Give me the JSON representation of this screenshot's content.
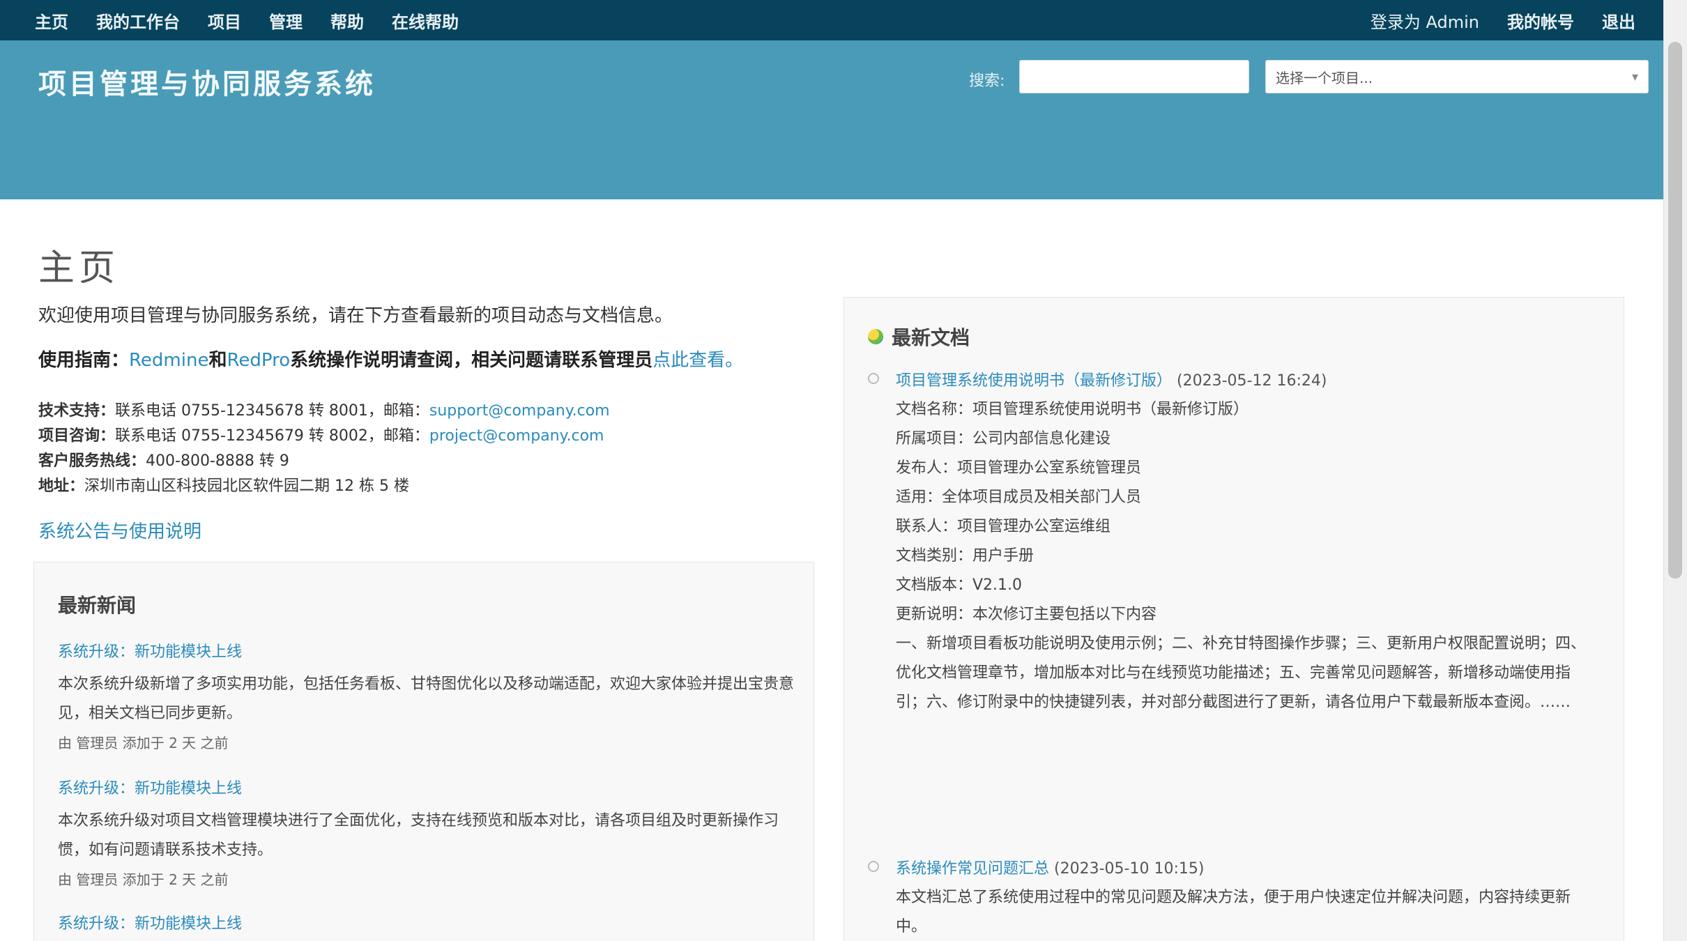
{
  "topbar": {
    "left_items": [
      "主页",
      "我的工作台",
      "项目",
      "管理",
      "帮助",
      "在线帮助"
    ],
    "right_items": [
      "登录为 Admin",
      "我的帐号",
      "退出"
    ]
  },
  "header": {
    "site_title": "项目管理与协同服务系统",
    "search_label": "搜索:",
    "search_value": "",
    "project_select": "选择一个项目..."
  },
  "main": {
    "heading": "主页",
    "intro": "欢迎使用项目管理与协同服务系统，请在下方查看最新的项目动态与文档信息。",
    "guide": {
      "prefix": "使用指南：",
      "link1": "Redmine",
      "middle": "和",
      "link2": "RedPro",
      "suffix": "系统操作说明请查阅，相关问题请联系管理员",
      "link3": "点此查看。"
    },
    "contacts": [
      {
        "label": "技术支持：",
        "text": "联系电话 0755-12345678 转 8001，邮箱：",
        "email": "support@company.com"
      },
      {
        "label": "项目咨询：",
        "text": "联系电话 0755-12345679 转 8002，邮箱：",
        "email": "project@company.com"
      },
      {
        "label": "客户服务热线：",
        "text": "400-800-8888 转 9",
        "email": ""
      },
      {
        "label": "地址：",
        "text": "深圳市南山区科技园北区软件园二期 12 栋 5 楼",
        "email": ""
      }
    ],
    "more_link": "系统公告与使用说明",
    "news": {
      "title": "最新新闻",
      "items": [
        {
          "title": "系统升级：新功能模块上线",
          "summary": "本次系统升级新增了多项实用功能，包括任务看板、甘特图优化以及移动端适配，欢迎大家体验并提出宝贵意见，相关文档已同步更新。",
          "meta": "由 管理员 添加于 2 天 之前"
        },
        {
          "title": "系统升级：新功能模块上线",
          "summary": "本次系统升级对项目文档管理模块进行了全面优化，支持在线预览和版本对比，请各项目组及时更新操作习惯，如有问题请联系技术支持。",
          "meta": "由 管理员 添加于 2 天 之前"
        },
        {
          "title": "系统升级：新功能模块上线",
          "summary": "",
          "meta": ""
        }
      ]
    }
  },
  "docs": {
    "title": "最新文档",
    "items": [
      {
        "link": "项目管理系统使用说明书（最新修订版）",
        "date": "(2023-05-12 16:24)",
        "lines": [
          "文档名称：项目管理系统使用说明书（最新修订版）",
          "所属项目：公司内部信息化建设",
          "发布人：项目管理办公室系统管理员",
          "适用：全体项目成员及相关部门人员",
          "联系人：项目管理办公室运维组",
          "文档类别：用户手册",
          "文档版本：V2.1.0",
          "更新说明：本次修订主要包括以下内容"
        ],
        "paragraph": "一、新增项目看板功能说明及使用示例；二、补充甘特图操作步骤；三、更新用户权限配置说明；四、优化文档管理章节，增加版本对比与在线预览功能描述；五、完善常见问题解答，新增移动端使用指引；六、修订附录中的快捷键列表，并对部分截图进行了更新，请各位用户下载最新版本查阅。……"
      },
      {
        "link": "系统操作常见问题汇总",
        "date": "(2023-05-10 10:15)",
        "lines": [],
        "paragraph": "本文档汇总了系统使用过程中的常见问题及解决方法，便于用户快速定位并解决问题，内容持续更新中。"
      }
    ]
  }
}
